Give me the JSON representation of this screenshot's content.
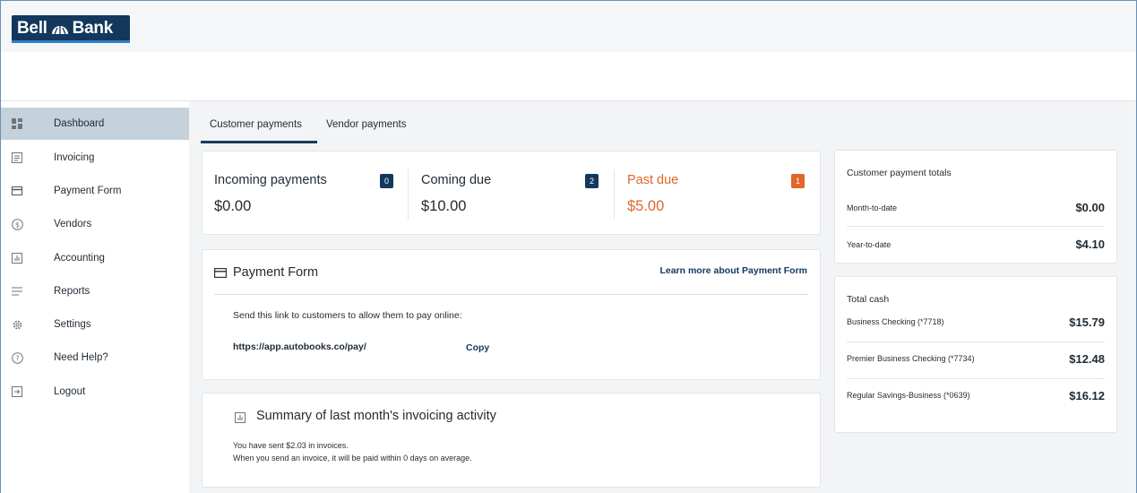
{
  "brand": {
    "name_left": "Bell",
    "name_right": "Bank",
    "color": "#13375d",
    "accent": "#2f7fc4"
  },
  "sidebar": {
    "items": [
      {
        "label": "Dashboard",
        "icon": "dashboard-icon",
        "active": true
      },
      {
        "label": "Invoicing",
        "icon": "invoice-icon",
        "active": false
      },
      {
        "label": "Payment Form",
        "icon": "card-icon",
        "active": false
      },
      {
        "label": "Vendors",
        "icon": "dollar-circle-icon",
        "active": false
      },
      {
        "label": "Accounting",
        "icon": "chart-box-icon",
        "active": false
      },
      {
        "label": "Reports",
        "icon": "lines-icon",
        "active": false
      },
      {
        "label": "Settings",
        "icon": "gear-icon",
        "active": false
      },
      {
        "label": "Need Help?",
        "icon": "help-circle-icon",
        "active": false
      },
      {
        "label": "Logout",
        "icon": "logout-icon",
        "active": false
      }
    ]
  },
  "tabs": [
    {
      "label": "Customer payments",
      "active": true
    },
    {
      "label": "Vendor payments",
      "active": false
    }
  ],
  "stats": [
    {
      "title": "Incoming payments",
      "value": "$0.00",
      "badge": "0",
      "badge_color": "#13375d",
      "text_color": "#1f2a33"
    },
    {
      "title": "Coming due",
      "value": "$10.00",
      "badge": "2",
      "badge_color": "#13375d",
      "text_color": "#1f2a33"
    },
    {
      "title": "Past due",
      "value": "$5.00",
      "badge": "1",
      "badge_color": "#e0662b",
      "text_color": "#e0662b"
    }
  ],
  "payment_form": {
    "title": "Payment Form",
    "learn_more": "Learn more about Payment Form",
    "description": "Send this link to customers to allow them to pay online:",
    "link": "https://app.autobooks.co/pay/",
    "copy_label": "Copy"
  },
  "summary": {
    "title": "Summary of last month's invoicing activity",
    "line1": "You have sent $2.03 in invoices.",
    "line2": "When you send an invoice, it will be paid within 0 days on average."
  },
  "customer_totals": {
    "title": "Customer payment totals",
    "rows": [
      {
        "label": "Month-to-date",
        "value": "$0.00"
      },
      {
        "label": "Year-to-date",
        "value": "$4.10"
      }
    ]
  },
  "total_cash": {
    "title": "Total cash",
    "rows": [
      {
        "label": "Business Checking (*7718)",
        "value": "$15.79"
      },
      {
        "label": "Premier Business Checking (*7734)",
        "value": "$12.48"
      },
      {
        "label": "Regular Savings-Business (*0639)",
        "value": "$16.12"
      }
    ]
  }
}
